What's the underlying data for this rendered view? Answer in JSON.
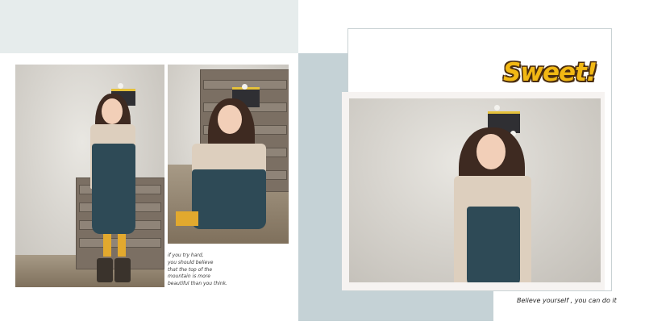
{
  "left_page": {
    "caption_lines": [
      "if you try hard,",
      "you should believe",
      "that the top of the",
      "mountain is more",
      "beautiful than you think."
    ]
  },
  "right_page": {
    "title": "Sweet!",
    "caption": "Believe yourself , you can do it"
  },
  "colors": {
    "band_top_left": "#e6ecec",
    "right_block": "#c5d2d6",
    "title_fill": "#f2b814",
    "title_outline": "#4a2d10",
    "dress": "#2e4a56"
  }
}
